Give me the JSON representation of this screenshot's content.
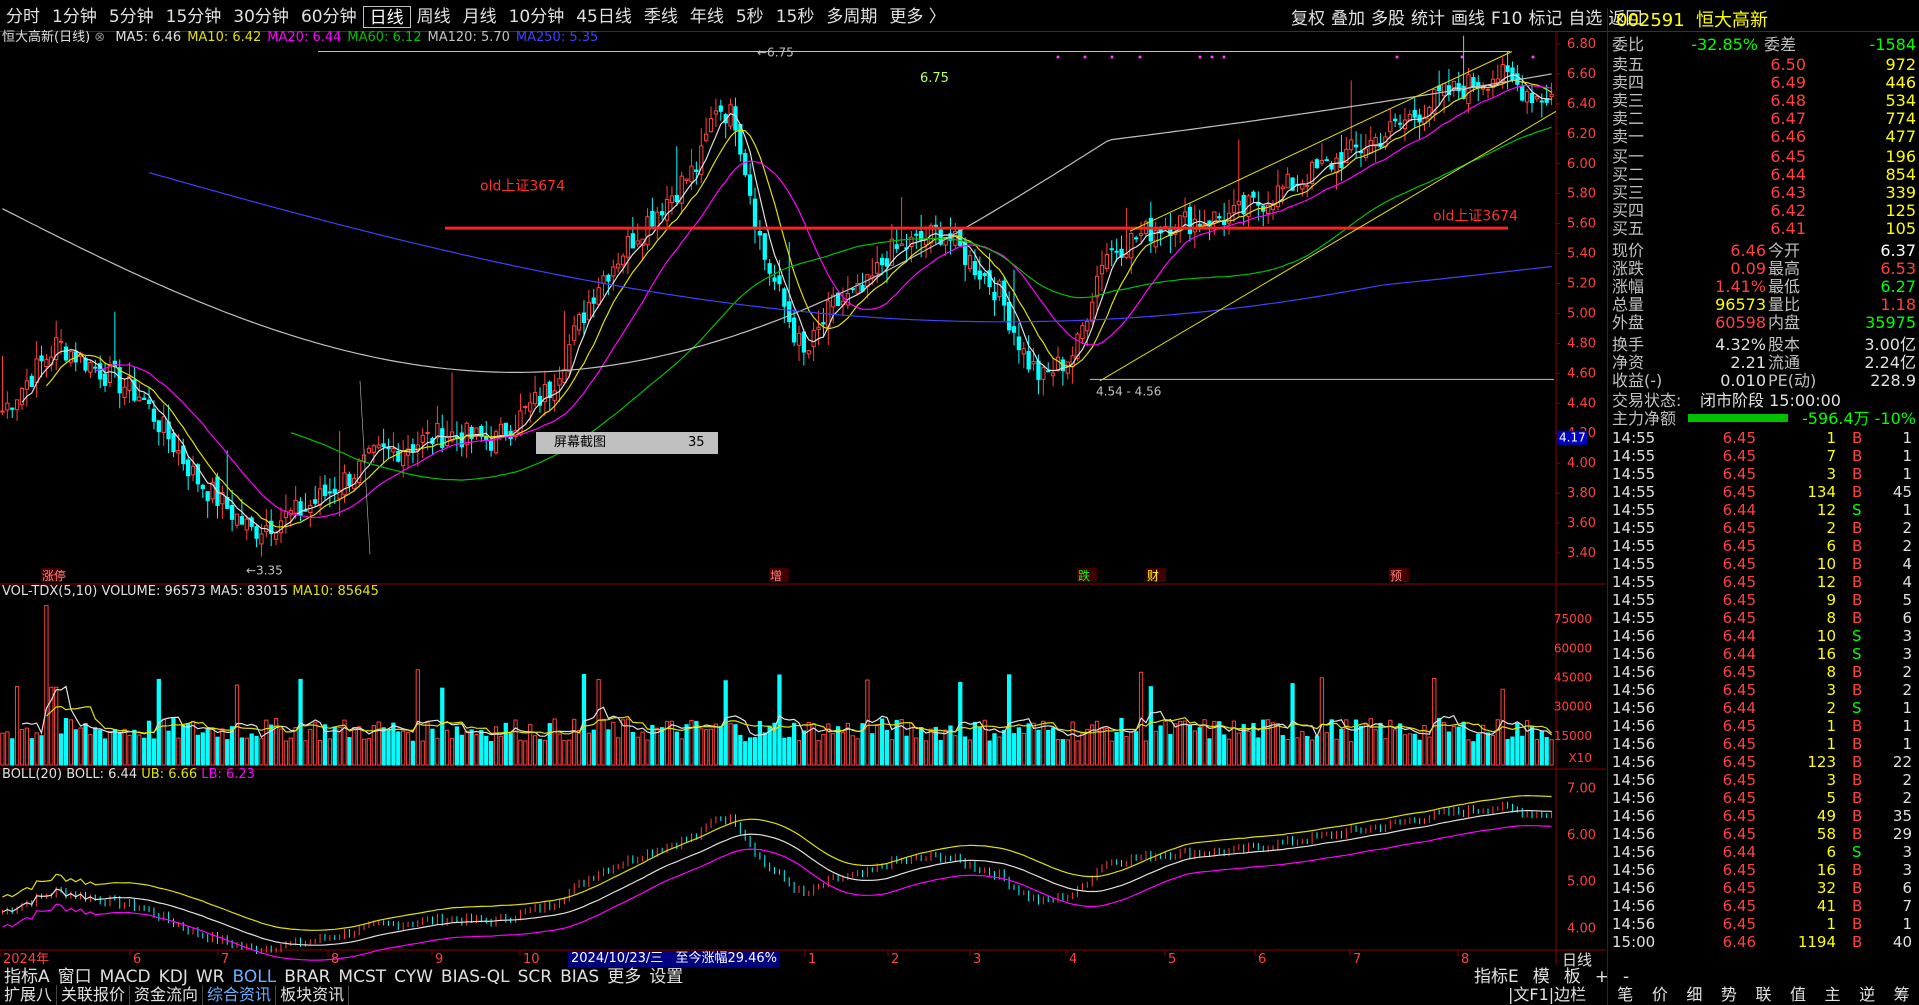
{
  "toolbar": {
    "periods": [
      "分时",
      "1分钟",
      "5分钟",
      "15分钟",
      "30分钟",
      "60分钟",
      "日线",
      "周线",
      "月线",
      "10分钟",
      "45日线",
      "季线",
      "年线",
      "5秒",
      "15秒",
      "多周期",
      "更多 〉"
    ],
    "active_period": "日线",
    "right_tools": [
      "复权",
      "叠加",
      "多股",
      "统计",
      "画线",
      "F10",
      "标记",
      "自选",
      "返回"
    ]
  },
  "main_chart": {
    "title": "恒大高新(日线)",
    "ma": [
      {
        "label": "MA5: 6.46",
        "color": "#e0e0e0"
      },
      {
        "label": "MA10: 6.42",
        "color": "#e0e000"
      },
      {
        "label": "MA20: 6.44",
        "color": "#ff00ff"
      },
      {
        "label": "MA60: 6.12",
        "color": "#00c000"
      },
      {
        "label": "MA120: 5.70",
        "color": "#c0c0c0"
      },
      {
        "label": "MA250: 5.35",
        "color": "#4040ff"
      }
    ],
    "y_ticks": [
      "6.80",
      "6.60",
      "6.40",
      "6.20",
      "6.00",
      "5.80",
      "5.60",
      "5.40",
      "5.20",
      "5.00",
      "4.80",
      "4.60",
      "4.40",
      "4.20",
      "4.00",
      "3.80",
      "3.60",
      "3.40"
    ],
    "current_price_marker": "4.17",
    "annotations": {
      "high": "6.75",
      "high_label": "6.75",
      "low": "3.35",
      "range_label": "4.54 - 4.56",
      "old_index_left": "old上证3674",
      "old_index_right": "old上证3674",
      "popup_text": "屏幕截图",
      "popup_value": "35"
    },
    "event_markers": [
      "涨停",
      "增",
      "跌",
      "财",
      "预"
    ]
  },
  "volume_chart": {
    "title": "VOL-TDX(5,10)",
    "volume": "VOLUME: 96573",
    "ma5": "MA5: 83015",
    "ma10": "MA10: 85645",
    "y_ticks": [
      "75000",
      "60000",
      "45000",
      "30000",
      "15000",
      "X10"
    ]
  },
  "boll_chart": {
    "title": "BOLL(20)",
    "boll": "BOLL: 6.44",
    "ub": "UB: 6.66",
    "lb": "LB: 6.23",
    "y_ticks": [
      "7.00",
      "6.00",
      "5.00",
      "4.00"
    ]
  },
  "x_axis": {
    "labels": [
      "2024年",
      "6",
      "7",
      "8",
      "9",
      "10",
      "1",
      "2",
      "3",
      "4",
      "5",
      "6",
      "7",
      "8"
    ],
    "info": "2024/10/23/三",
    "info2": "至今涨幅29.46%",
    "unit": "日线"
  },
  "indicator_tabs": [
    "指标A",
    "窗口",
    "MACD",
    "KDJ",
    "WR",
    "BOLL",
    "BRAR",
    "MCST",
    "CYW",
    "BIAS-QL",
    "SCR",
    "BIAS",
    "更多",
    "设置"
  ],
  "active_indicator": "BOLL",
  "indicator_right": [
    "指标E",
    "模",
    "板",
    "+",
    "-"
  ],
  "bottom_tabs": [
    "扩展八",
    "关联报价",
    "资金流向",
    "综合资讯",
    "板块资讯"
  ],
  "active_bottom_tab": "综合资讯",
  "bottom_right": "|文F1|边栏",
  "quote": {
    "code": "002591",
    "name": "恒大高新",
    "weibi_label": "委比",
    "weibi": "-32.85%",
    "weicha_label": "委差",
    "weicha": "-1584",
    "asks": [
      {
        "label": "卖五",
        "price": "6.50",
        "vol": "972"
      },
      {
        "label": "卖四",
        "price": "6.49",
        "vol": "446"
      },
      {
        "label": "卖三",
        "price": "6.48",
        "vol": "534"
      },
      {
        "label": "卖二",
        "price": "6.47",
        "vol": "774"
      },
      {
        "label": "卖一",
        "price": "6.46",
        "vol": "477"
      }
    ],
    "bids": [
      {
        "label": "买一",
        "price": "6.45",
        "vol": "196"
      },
      {
        "label": "买二",
        "price": "6.44",
        "vol": "854"
      },
      {
        "label": "买三",
        "price": "6.43",
        "vol": "339"
      },
      {
        "label": "买四",
        "price": "6.42",
        "vol": "125"
      },
      {
        "label": "买五",
        "price": "6.41",
        "vol": "105"
      }
    ],
    "stats": [
      {
        "l1": "现价",
        "v1": "6.46",
        "c1": "#ff4040",
        "l2": "今开",
        "v2": "6.37",
        "c2": "#ffffff"
      },
      {
        "l1": "涨跌",
        "v1": "0.09",
        "c1": "#ff4040",
        "l2": "最高",
        "v2": "6.53",
        "c2": "#ff4040"
      },
      {
        "l1": "涨幅",
        "v1": "1.41%",
        "c1": "#ff4040",
        "l2": "最低",
        "v2": "6.27",
        "c2": "#00ff00"
      },
      {
        "l1": "总量",
        "v1": "96573",
        "c1": "#ffff00",
        "l2": "量比",
        "v2": "1.18",
        "c2": "#ff4040"
      },
      {
        "l1": "外盘",
        "v1": "60598",
        "c1": "#ff4040",
        "l2": "内盘",
        "v2": "35975",
        "c2": "#00ff00"
      }
    ],
    "stats2": [
      {
        "l1": "换手",
        "v1": "4.32%",
        "l2": "股本",
        "v2": "3.00亿"
      },
      {
        "l1": "净资",
        "v1": "2.21",
        "l2": "流通",
        "v2": "2.24亿"
      },
      {
        "l1": "收益(-)",
        "v1": "0.010",
        "l2": "PE(动)",
        "v2": "228.9"
      }
    ],
    "status_label": "交易状态:",
    "status": "闭市阶段 15:00:00",
    "main_flow_label": "主力净额",
    "main_flow": "-596.4万 -10%",
    "ticks": [
      {
        "t": "14:55",
        "p": "6.45",
        "v": "1",
        "s": "B",
        "n": "1"
      },
      {
        "t": "14:55",
        "p": "6.45",
        "v": "7",
        "s": "B",
        "n": "1"
      },
      {
        "t": "14:55",
        "p": "6.45",
        "v": "3",
        "s": "B",
        "n": "1"
      },
      {
        "t": "14:55",
        "p": "6.45",
        "v": "134",
        "s": "B",
        "n": "45"
      },
      {
        "t": "14:55",
        "p": "6.44",
        "v": "12",
        "s": "S",
        "n": "1"
      },
      {
        "t": "14:55",
        "p": "6.45",
        "v": "2",
        "s": "B",
        "n": "2"
      },
      {
        "t": "14:55",
        "p": "6.45",
        "v": "6",
        "s": "B",
        "n": "2"
      },
      {
        "t": "14:55",
        "p": "6.45",
        "v": "10",
        "s": "B",
        "n": "4"
      },
      {
        "t": "14:55",
        "p": "6.45",
        "v": "12",
        "s": "B",
        "n": "4"
      },
      {
        "t": "14:55",
        "p": "6.45",
        "v": "9",
        "s": "B",
        "n": "5"
      },
      {
        "t": "14:55",
        "p": "6.45",
        "v": "8",
        "s": "B",
        "n": "6"
      },
      {
        "t": "14:56",
        "p": "6.44",
        "v": "10",
        "s": "S",
        "n": "3"
      },
      {
        "t": "14:56",
        "p": "6.44",
        "v": "16",
        "s": "S",
        "n": "3"
      },
      {
        "t": "14:56",
        "p": "6.45",
        "v": "8",
        "s": "B",
        "n": "2"
      },
      {
        "t": "14:56",
        "p": "6.45",
        "v": "3",
        "s": "B",
        "n": "2"
      },
      {
        "t": "14:56",
        "p": "6.44",
        "v": "2",
        "s": "S",
        "n": "1"
      },
      {
        "t": "14:56",
        "p": "6.45",
        "v": "1",
        "s": "B",
        "n": "1"
      },
      {
        "t": "14:56",
        "p": "6.45",
        "v": "1",
        "s": "B",
        "n": "1"
      },
      {
        "t": "14:56",
        "p": "6.45",
        "v": "123",
        "s": "B",
        "n": "22"
      },
      {
        "t": "14:56",
        "p": "6.45",
        "v": "3",
        "s": "B",
        "n": "2"
      },
      {
        "t": "14:56",
        "p": "6.45",
        "v": "5",
        "s": "B",
        "n": "2"
      },
      {
        "t": "14:56",
        "p": "6.45",
        "v": "49",
        "s": "B",
        "n": "35"
      },
      {
        "t": "14:56",
        "p": "6.45",
        "v": "58",
        "s": "B",
        "n": "29"
      },
      {
        "t": "14:56",
        "p": "6.44",
        "v": "6",
        "s": "S",
        "n": "3"
      },
      {
        "t": "14:56",
        "p": "6.45",
        "v": "16",
        "s": "B",
        "n": "3"
      },
      {
        "t": "14:56",
        "p": "6.45",
        "v": "32",
        "s": "B",
        "n": "6"
      },
      {
        "t": "14:56",
        "p": "6.45",
        "v": "41",
        "s": "B",
        "n": "7"
      },
      {
        "t": "14:56",
        "p": "6.45",
        "v": "1",
        "s": "B",
        "n": "1"
      },
      {
        "t": "15:00",
        "p": "6.46",
        "v": "1194",
        "s": "B",
        "n": "40"
      }
    ],
    "bottom_tabs": [
      "笔",
      "价",
      "细",
      "势",
      "联",
      "值",
      "主",
      "逆",
      "筹"
    ]
  },
  "colors": {
    "up": "#ff4040",
    "down": "#00ffff",
    "grid_red": "#8b0000",
    "ma5": "#e0e0e0",
    "ma10": "#e0e000",
    "ma20": "#ff00ff",
    "ma60": "#00c000",
    "ma120": "#c0c0c0",
    "ma250": "#4040ff"
  }
}
